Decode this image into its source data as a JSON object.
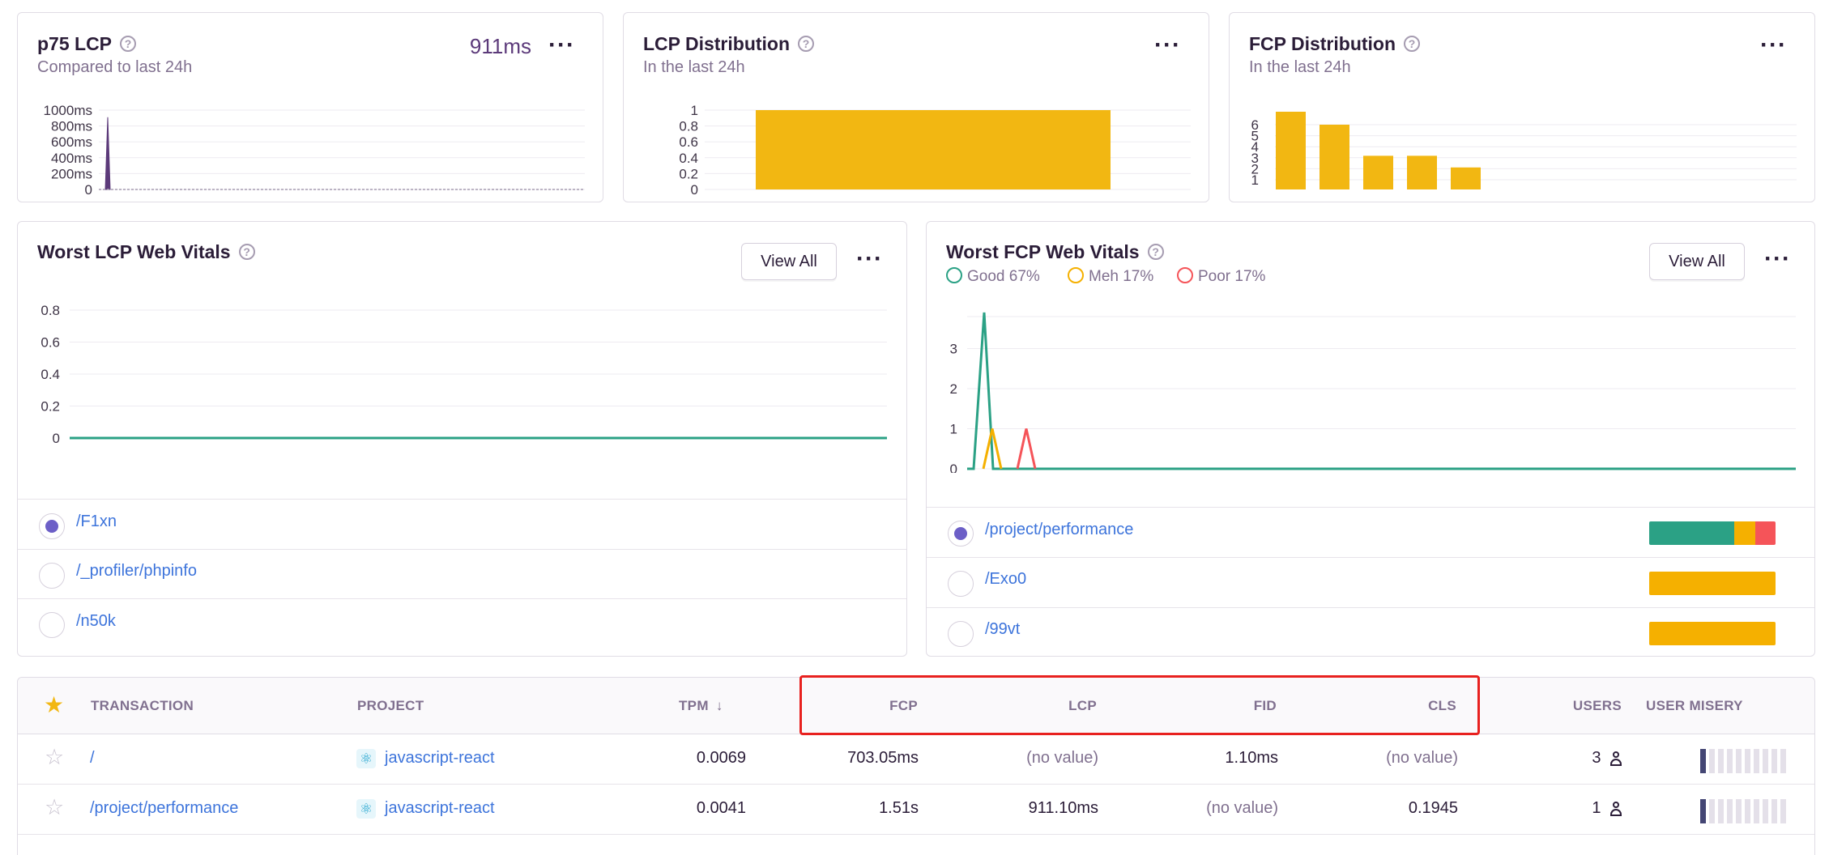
{
  "colors": {
    "accent_purple": "#6c5fc7",
    "link_blue": "#3d74db",
    "chart_yellow": "#f2b712",
    "good_green": "#2ba185",
    "meh_yellow": "#f5b000",
    "poor_red": "#f55459",
    "lcp_purple": "#5c3a7a",
    "highlight_red": "#e8211f"
  },
  "p75_lcp": {
    "title": "p75 LCP",
    "subtitle": "Compared to last 24h",
    "value": "911ms",
    "menu": "···"
  },
  "lcp_distribution": {
    "title": "LCP Distribution",
    "subtitle": "In the last 24h",
    "menu": "···"
  },
  "fcp_distribution": {
    "title": "FCP Distribution",
    "subtitle": "In the last 24h",
    "menu": "···"
  },
  "worst_lcp": {
    "title": "Worst LCP Web Vitals",
    "view_all": "View All",
    "menu": "···",
    "items": [
      {
        "label": "/F1xn",
        "selected": true
      },
      {
        "label": "/_profiler/phpinfo",
        "selected": false
      },
      {
        "label": "/n50k",
        "selected": false
      }
    ]
  },
  "worst_fcp": {
    "title": "Worst FCP Web Vitals",
    "view_all": "View All",
    "menu": "···",
    "legend": [
      {
        "label": "Good 67%",
        "color": "#2ba185"
      },
      {
        "label": "Meh 17%",
        "color": "#f5b000"
      },
      {
        "label": "Poor 17%",
        "color": "#f55459"
      }
    ],
    "items": [
      {
        "label": "/project/performance",
        "selected": true,
        "bar": {
          "good": 0.67,
          "meh": 0.17,
          "poor": 0.16
        }
      },
      {
        "label": "/Exo0",
        "selected": false,
        "bar": {
          "good": 0,
          "meh": 1,
          "poor": 0
        }
      },
      {
        "label": "/99vt",
        "selected": false,
        "bar": {
          "good": 0,
          "meh": 1,
          "poor": 0
        }
      }
    ]
  },
  "table": {
    "headers": {
      "transaction": "TRANSACTION",
      "project": "PROJECT",
      "tpm": "TPM",
      "fcp": "FCP",
      "lcp": "LCP",
      "fid": "FID",
      "cls": "CLS",
      "users": "USERS",
      "user_misery": "USER MISERY"
    },
    "rows": [
      {
        "transaction": "/",
        "project": "javascript-react",
        "tpm": "0.0069",
        "fcp": "703.05ms",
        "lcp": "(no value)",
        "fid": "1.10ms",
        "cls": "(no value)",
        "users": "3",
        "misery_level": 0.0
      },
      {
        "transaction": "/project/performance",
        "project": "javascript-react",
        "tpm": "0.0041",
        "fcp": "1.51s",
        "lcp": "911.10ms",
        "fid": "(no value)",
        "cls": "0.1945",
        "users": "1",
        "misery_level": 0.0
      }
    ]
  },
  "chart_data": [
    {
      "type": "area",
      "title": "p75 LCP",
      "yticks": [
        "1000ms",
        "800ms",
        "600ms",
        "400ms",
        "200ms",
        "0"
      ],
      "ylim": [
        0,
        1000
      ],
      "series": [
        {
          "values": [
            0,
            911,
            0,
            0,
            0,
            0,
            0,
            0,
            0,
            0,
            0,
            0,
            0,
            0,
            0,
            0,
            0,
            0,
            0,
            0,
            0,
            0,
            0,
            0,
            0,
            0,
            0,
            0,
            0,
            0
          ]
        }
      ]
    },
    {
      "type": "bar",
      "title": "LCP Distribution",
      "yticks": [
        "1",
        "0.8",
        "0.6",
        "0.4",
        "0.2",
        "0"
      ],
      "ylim": [
        0,
        1
      ],
      "values": [
        1
      ]
    },
    {
      "type": "bar",
      "title": "FCP Distribution",
      "yticks": [
        "6",
        "5",
        "4",
        "3",
        "2",
        "1"
      ],
      "ylim": [
        0,
        6
      ],
      "values": [
        6,
        5,
        2.6,
        2.6,
        1.7
      ]
    },
    {
      "type": "line",
      "title": "Worst LCP Web Vitals",
      "yticks": [
        "0.8",
        "0.6",
        "0.4",
        "0.2",
        "0"
      ],
      "ylim": [
        0,
        1
      ],
      "series": [
        {
          "values": [
            0,
            0
          ]
        }
      ]
    },
    {
      "type": "line",
      "title": "Worst FCP Web Vitals",
      "yticks": [
        "3",
        "2",
        "1",
        "0"
      ],
      "ylim": [
        0,
        4
      ],
      "series": [
        {
          "name": "Good",
          "values": [
            0,
            3.9,
            0,
            0,
            0,
            0,
            0
          ]
        },
        {
          "name": "Meh",
          "values": [
            0,
            0,
            1,
            0,
            0,
            0,
            0
          ]
        },
        {
          "name": "Poor",
          "values": [
            0,
            0,
            0,
            0,
            1,
            0,
            0
          ]
        }
      ]
    }
  ]
}
